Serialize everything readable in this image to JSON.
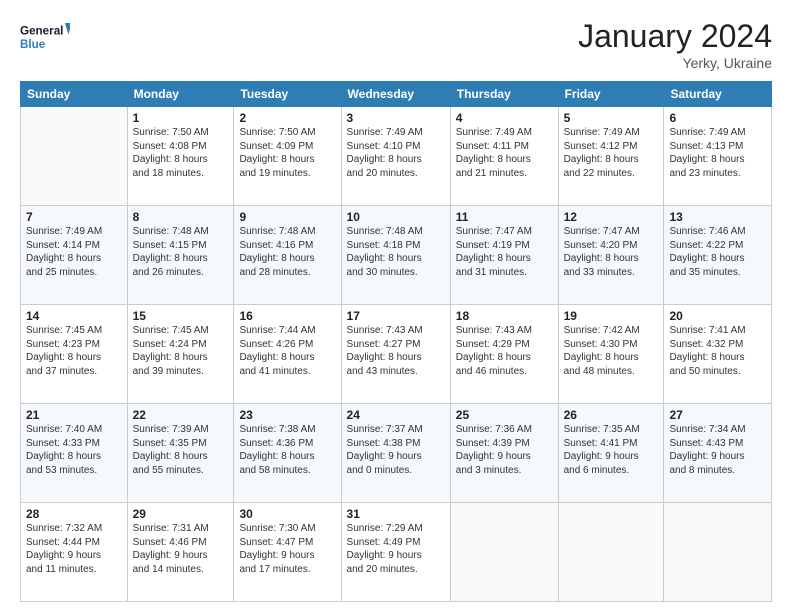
{
  "header": {
    "logo_line1": "General",
    "logo_line2": "Blue",
    "title": "January 2024",
    "subtitle": "Yerky, Ukraine"
  },
  "days_of_week": [
    "Sunday",
    "Monday",
    "Tuesday",
    "Wednesday",
    "Thursday",
    "Friday",
    "Saturday"
  ],
  "weeks": [
    [
      {
        "day": "",
        "info": ""
      },
      {
        "day": "1",
        "info": "Sunrise: 7:50 AM\nSunset: 4:08 PM\nDaylight: 8 hours\nand 18 minutes."
      },
      {
        "day": "2",
        "info": "Sunrise: 7:50 AM\nSunset: 4:09 PM\nDaylight: 8 hours\nand 19 minutes."
      },
      {
        "day": "3",
        "info": "Sunrise: 7:49 AM\nSunset: 4:10 PM\nDaylight: 8 hours\nand 20 minutes."
      },
      {
        "day": "4",
        "info": "Sunrise: 7:49 AM\nSunset: 4:11 PM\nDaylight: 8 hours\nand 21 minutes."
      },
      {
        "day": "5",
        "info": "Sunrise: 7:49 AM\nSunset: 4:12 PM\nDaylight: 8 hours\nand 22 minutes."
      },
      {
        "day": "6",
        "info": "Sunrise: 7:49 AM\nSunset: 4:13 PM\nDaylight: 8 hours\nand 23 minutes."
      }
    ],
    [
      {
        "day": "7",
        "info": "Sunrise: 7:49 AM\nSunset: 4:14 PM\nDaylight: 8 hours\nand 25 minutes."
      },
      {
        "day": "8",
        "info": "Sunrise: 7:48 AM\nSunset: 4:15 PM\nDaylight: 8 hours\nand 26 minutes."
      },
      {
        "day": "9",
        "info": "Sunrise: 7:48 AM\nSunset: 4:16 PM\nDaylight: 8 hours\nand 28 minutes."
      },
      {
        "day": "10",
        "info": "Sunrise: 7:48 AM\nSunset: 4:18 PM\nDaylight: 8 hours\nand 30 minutes."
      },
      {
        "day": "11",
        "info": "Sunrise: 7:47 AM\nSunset: 4:19 PM\nDaylight: 8 hours\nand 31 minutes."
      },
      {
        "day": "12",
        "info": "Sunrise: 7:47 AM\nSunset: 4:20 PM\nDaylight: 8 hours\nand 33 minutes."
      },
      {
        "day": "13",
        "info": "Sunrise: 7:46 AM\nSunset: 4:22 PM\nDaylight: 8 hours\nand 35 minutes."
      }
    ],
    [
      {
        "day": "14",
        "info": "Sunrise: 7:45 AM\nSunset: 4:23 PM\nDaylight: 8 hours\nand 37 minutes."
      },
      {
        "day": "15",
        "info": "Sunrise: 7:45 AM\nSunset: 4:24 PM\nDaylight: 8 hours\nand 39 minutes."
      },
      {
        "day": "16",
        "info": "Sunrise: 7:44 AM\nSunset: 4:26 PM\nDaylight: 8 hours\nand 41 minutes."
      },
      {
        "day": "17",
        "info": "Sunrise: 7:43 AM\nSunset: 4:27 PM\nDaylight: 8 hours\nand 43 minutes."
      },
      {
        "day": "18",
        "info": "Sunrise: 7:43 AM\nSunset: 4:29 PM\nDaylight: 8 hours\nand 46 minutes."
      },
      {
        "day": "19",
        "info": "Sunrise: 7:42 AM\nSunset: 4:30 PM\nDaylight: 8 hours\nand 48 minutes."
      },
      {
        "day": "20",
        "info": "Sunrise: 7:41 AM\nSunset: 4:32 PM\nDaylight: 8 hours\nand 50 minutes."
      }
    ],
    [
      {
        "day": "21",
        "info": "Sunrise: 7:40 AM\nSunset: 4:33 PM\nDaylight: 8 hours\nand 53 minutes."
      },
      {
        "day": "22",
        "info": "Sunrise: 7:39 AM\nSunset: 4:35 PM\nDaylight: 8 hours\nand 55 minutes."
      },
      {
        "day": "23",
        "info": "Sunrise: 7:38 AM\nSunset: 4:36 PM\nDaylight: 8 hours\nand 58 minutes."
      },
      {
        "day": "24",
        "info": "Sunrise: 7:37 AM\nSunset: 4:38 PM\nDaylight: 9 hours\nand 0 minutes."
      },
      {
        "day": "25",
        "info": "Sunrise: 7:36 AM\nSunset: 4:39 PM\nDaylight: 9 hours\nand 3 minutes."
      },
      {
        "day": "26",
        "info": "Sunrise: 7:35 AM\nSunset: 4:41 PM\nDaylight: 9 hours\nand 6 minutes."
      },
      {
        "day": "27",
        "info": "Sunrise: 7:34 AM\nSunset: 4:43 PM\nDaylight: 9 hours\nand 8 minutes."
      }
    ],
    [
      {
        "day": "28",
        "info": "Sunrise: 7:32 AM\nSunset: 4:44 PM\nDaylight: 9 hours\nand 11 minutes."
      },
      {
        "day": "29",
        "info": "Sunrise: 7:31 AM\nSunset: 4:46 PM\nDaylight: 9 hours\nand 14 minutes."
      },
      {
        "day": "30",
        "info": "Sunrise: 7:30 AM\nSunset: 4:47 PM\nDaylight: 9 hours\nand 17 minutes."
      },
      {
        "day": "31",
        "info": "Sunrise: 7:29 AM\nSunset: 4:49 PM\nDaylight: 9 hours\nand 20 minutes."
      },
      {
        "day": "",
        "info": ""
      },
      {
        "day": "",
        "info": ""
      },
      {
        "day": "",
        "info": ""
      }
    ]
  ]
}
